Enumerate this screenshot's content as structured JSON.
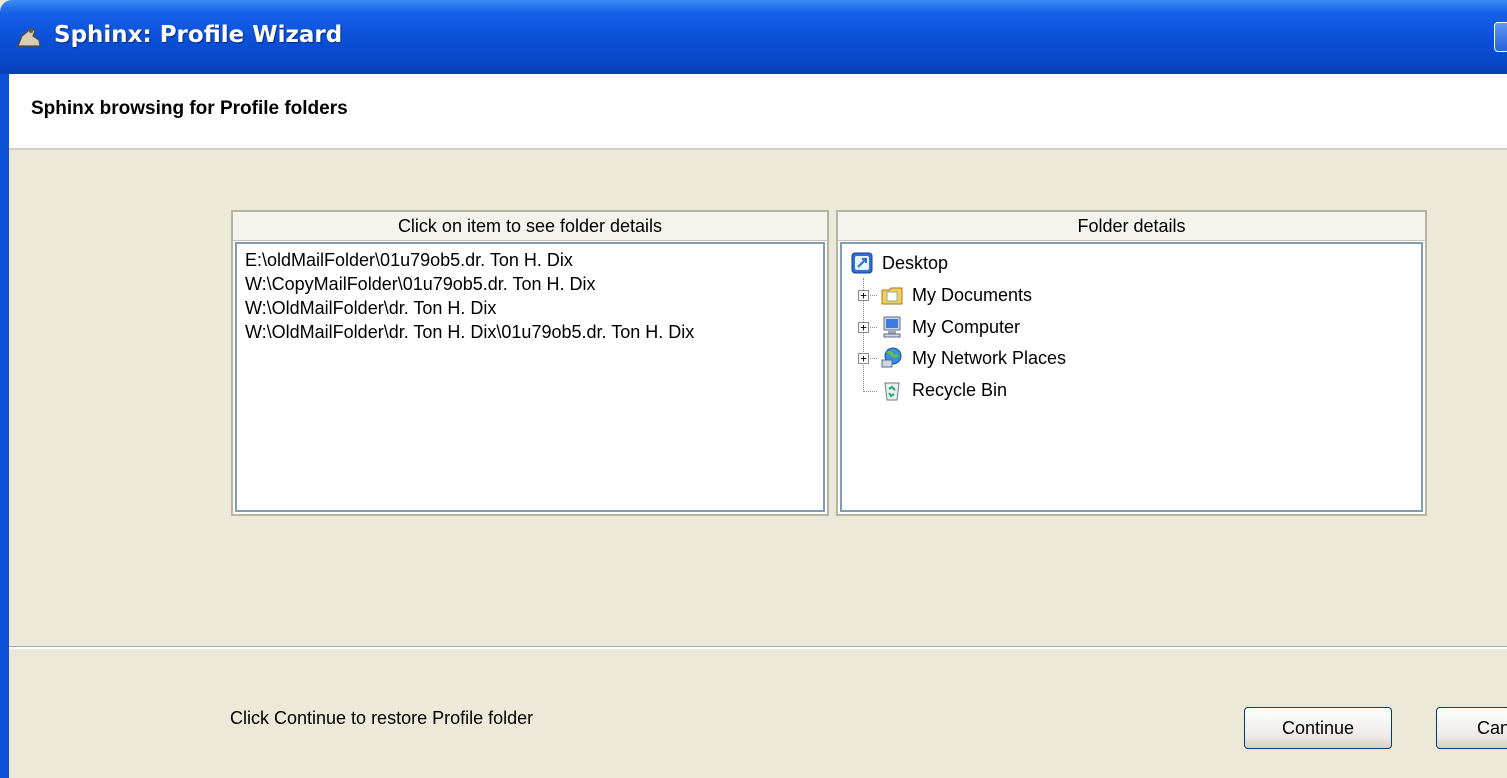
{
  "window": {
    "title": "Sphinx: Profile Wizard",
    "icon": "sphinx-app-icon"
  },
  "header": {
    "title": "Sphinx browsing for Profile folders"
  },
  "left_panel": {
    "header": "Click on item to see folder details",
    "items": [
      "E:\\oldMailFolder\\01u79ob5.dr. Ton H. Dix",
      "W:\\CopyMailFolder\\01u79ob5.dr. Ton H. Dix",
      "W:\\OldMailFolder\\dr. Ton H. Dix",
      "W:\\OldMailFolder\\dr. Ton H. Dix\\01u79ob5.dr. Ton H. Dix"
    ]
  },
  "right_panel": {
    "header": "Folder details",
    "tree": {
      "root": {
        "label": "Desktop",
        "icon": "desktop-icon"
      },
      "children": [
        {
          "label": "My Documents",
          "icon": "my-documents-icon",
          "expandable": true
        },
        {
          "label": "My Computer",
          "icon": "my-computer-icon",
          "expandable": true
        },
        {
          "label": "My Network Places",
          "icon": "network-places-icon",
          "expandable": true
        },
        {
          "label": "Recycle Bin",
          "icon": "recycle-bin-icon",
          "expandable": false
        }
      ],
      "expander_glyph": "+"
    }
  },
  "footer": {
    "status": "Click Continue to restore Profile folder",
    "continue_label": "Continue",
    "cancel_label": "Cancel"
  },
  "colors": {
    "titlebar": "#0a4fd6",
    "window_bg": "#ece9d8",
    "list_border": "#7f9db9"
  }
}
